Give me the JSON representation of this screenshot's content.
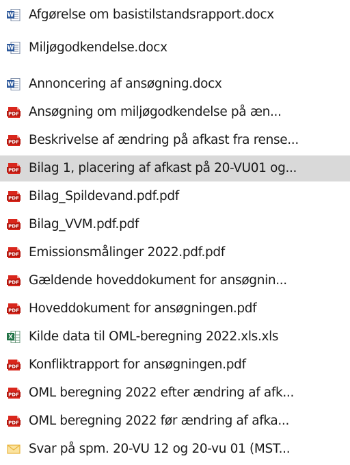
{
  "files": [
    {
      "name": "Afgørelse om basistilstandsrapport.docx",
      "icon": "word-icon",
      "selected": false
    },
    {
      "name": "Miljøgodkendelse.docx",
      "icon": "word-icon",
      "selected": false
    },
    {
      "name": "Annoncering af ansøgning.docx",
      "icon": "word-icon",
      "selected": false
    },
    {
      "name": "Ansøgning om miljøgodkendelse på æn...",
      "icon": "pdf-icon",
      "selected": false
    },
    {
      "name": "Beskrivelse af ændring på afkast fra rense...",
      "icon": "pdf-icon",
      "selected": false
    },
    {
      "name": "Bilag 1, placering af afkast på 20-VU01 og...",
      "icon": "pdf-icon",
      "selected": true
    },
    {
      "name": "Bilag_Spildevand.pdf.pdf",
      "icon": "pdf-icon",
      "selected": false
    },
    {
      "name": "Bilag_VVM.pdf.pdf",
      "icon": "pdf-icon",
      "selected": false
    },
    {
      "name": "Emissionsmålinger 2022.pdf.pdf",
      "icon": "pdf-icon",
      "selected": false
    },
    {
      "name": "Gældende hoveddokument for ansøgnin...",
      "icon": "pdf-icon",
      "selected": false
    },
    {
      "name": "Hoveddokument for ansøgningen.pdf",
      "icon": "pdf-icon",
      "selected": false
    },
    {
      "name": "Kilde data til OML-beregning 2022.xls.xls",
      "icon": "excel-icon",
      "selected": false
    },
    {
      "name": "Konfliktrapport for ansøgningen.pdf",
      "icon": "pdf-icon",
      "selected": false
    },
    {
      "name": "OML beregning 2022 efter ændring af afk...",
      "icon": "pdf-icon",
      "selected": false
    },
    {
      "name": "OML beregning 2022 før ændring af afka...",
      "icon": "pdf-icon",
      "selected": false
    },
    {
      "name": "Svar på spm.  20-VU 12 og 20-vu 01 (MST...",
      "icon": "mail-icon",
      "selected": false
    }
  ],
  "colors": {
    "word": "#2b579a",
    "pdf": "#d9261c",
    "excel": "#217346",
    "mail": "#e8b43c",
    "selection": "#d9d9d9"
  }
}
